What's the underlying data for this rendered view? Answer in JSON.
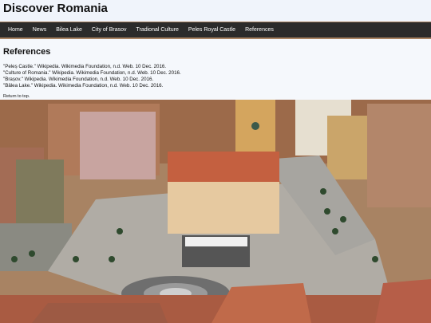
{
  "header": {
    "title": "Discover Romania"
  },
  "nav": {
    "items": [
      {
        "label": "Home"
      },
      {
        "label": "News"
      },
      {
        "label": "Bilea Lake"
      },
      {
        "label": "City of Brasov"
      },
      {
        "label": "Tradional Culture"
      },
      {
        "label": "Peles Royal Castle"
      },
      {
        "label": "References"
      }
    ]
  },
  "main": {
    "section_title": "References",
    "references": [
      "\"Peleș Castle.\" Wikipedia. Wikimedia Foundation, n.d. Web. 10 Dec. 2016.",
      "\"Culture of Romania.\" Wikipedia. Wikimedia Foundation, n.d. Web. 10 Dec. 2016.",
      "\"Brașov.\" Wikipedia. Wikimedia Foundation, n.d. Web. 10 Dec. 2016.",
      "\"Bâlea Lake.\" Wikipedia. Wikimedia Foundation, n.d. Web. 10 Dec. 2016."
    ],
    "back_to_top": "Return to top."
  },
  "colors": {
    "header_bg": "#f0f4fb",
    "nav_bg": "#2b2b2b",
    "content_bg": "#f5f8fc"
  }
}
